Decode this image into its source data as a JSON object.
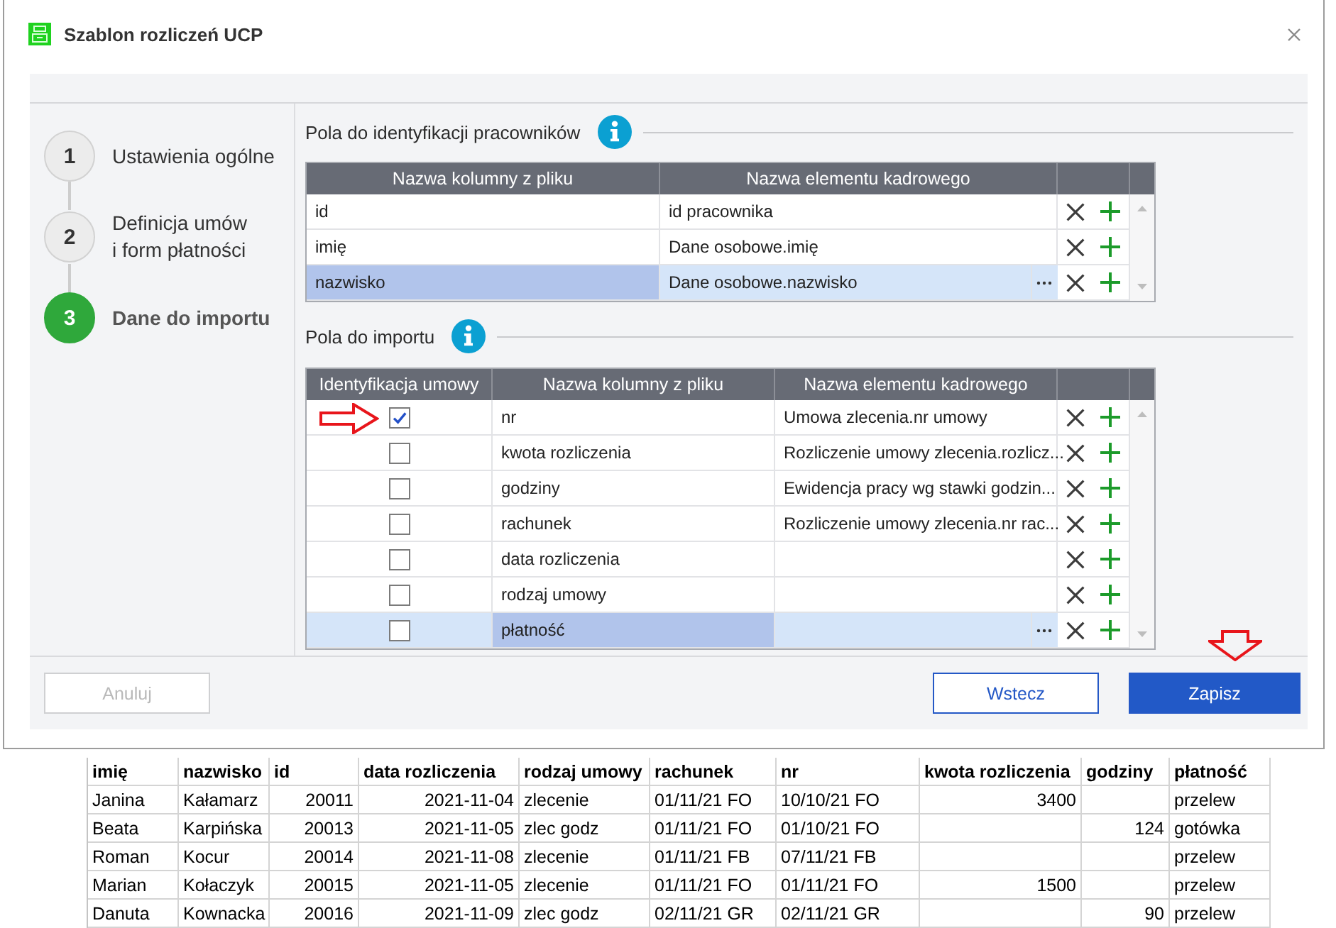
{
  "window": {
    "title": "Szablon rozliczeń UCP"
  },
  "steps": [
    {
      "number": "1",
      "label": "Ustawienia ogólne",
      "selected": false
    },
    {
      "number": "2",
      "label": "Definicja umów\ni form płatności",
      "selected": false
    },
    {
      "number": "3",
      "label": "Dane do importu",
      "selected": true
    }
  ],
  "employee_fields": {
    "title": "Pola do identyfikacji pracowników",
    "columns": [
      "Nazwa kolumny z pliku",
      "Nazwa elementu kadrowego"
    ],
    "rows": [
      {
        "file_column": "id",
        "hr_element": "id pracownika",
        "selected": false
      },
      {
        "file_column": "imię",
        "hr_element": "Dane osobowe.imię",
        "selected": false
      },
      {
        "file_column": "nazwisko",
        "hr_element": "Dane osobowe.nazwisko",
        "selected": true
      }
    ]
  },
  "import_fields": {
    "title": "Pola do importu",
    "columns": [
      "Identyfikacja umowy",
      "Nazwa kolumny z pliku",
      "Nazwa elementu kadrowego"
    ],
    "rows": [
      {
        "contract_id": true,
        "file_column": "nr",
        "hr_element": "Umowa zlecenia.nr umowy",
        "selected": false
      },
      {
        "contract_id": false,
        "file_column": "kwota rozliczenia",
        "hr_element": "Rozliczenie umowy zlecenia.rozlicz...",
        "selected": false
      },
      {
        "contract_id": false,
        "file_column": "godziny",
        "hr_element": "Ewidencja pracy wg stawki godzin...",
        "selected": false
      },
      {
        "contract_id": false,
        "file_column": "rachunek",
        "hr_element": "Rozliczenie umowy zlecenia.nr rac...",
        "selected": false
      },
      {
        "contract_id": false,
        "file_column": "data rozliczenia",
        "selected": false
      },
      {
        "contract_id": false,
        "file_column": "rodzaj umowy",
        "selected": false
      },
      {
        "contract_id": false,
        "file_column": "płatność",
        "selected": true
      }
    ]
  },
  "footer": {
    "cancel_button": {
      "label": "Anuluj",
      "disabled": true
    },
    "back_button": {
      "label": "Wstecz",
      "disabled": false
    },
    "save_button": {
      "label": "Zapisz",
      "disabled": false
    }
  },
  "spreadsheet": {
    "columns": [
      {
        "label": "imię",
        "kind": "text"
      },
      {
        "label": "nazwisko",
        "kind": "text"
      },
      {
        "label": "id",
        "kind": "number"
      },
      {
        "label": "data rozliczenia",
        "kind": "number"
      },
      {
        "label": "rodzaj umowy",
        "kind": "text"
      },
      {
        "label": "rachunek",
        "kind": "text"
      },
      {
        "label": "nr",
        "kind": "text"
      },
      {
        "label": "kwota rozliczenia",
        "kind": "number"
      },
      {
        "label": "godziny",
        "kind": "number"
      },
      {
        "label": "płatność",
        "kind": "text"
      }
    ],
    "rows": [
      [
        "Janina",
        "Kałamarz",
        "20011",
        "2021-11-04",
        "zlecenie",
        "01/11/21 FO",
        "10/10/21 FO",
        "3400",
        null,
        "przelew"
      ],
      [
        "Beata",
        "Karpińska",
        "20013",
        "2021-11-05",
        "zlec godz",
        "01/11/21 FO",
        "01/10/21 FO",
        null,
        "124",
        "gotówka"
      ],
      [
        "Roman",
        "Kocur",
        "20014",
        "2021-11-08",
        "zlecenie",
        "01/11/21 FB",
        "07/11/21 FB",
        null,
        null,
        "przelew"
      ],
      [
        "Marian",
        "Kołaczyk",
        "20015",
        "2021-11-05",
        "zlecenie",
        "01/11/21 FO",
        "01/11/21 FO",
        "1500",
        null,
        "przelew"
      ],
      [
        "Danuta",
        "Kownacka",
        "20016",
        "2021-11-09",
        "zlec godz",
        "02/11/21 GR",
        "02/11/21 GR",
        null,
        "90",
        "przelew"
      ]
    ]
  }
}
